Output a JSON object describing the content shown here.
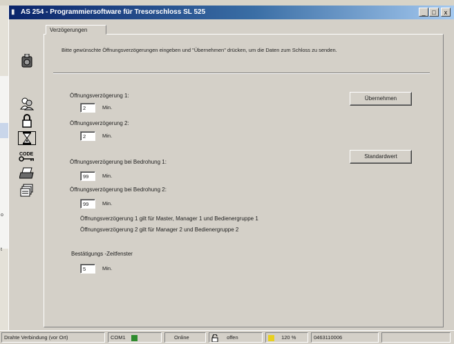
{
  "window": {
    "title": "AS 254 - Programmiersoftware für Tresorschloss SL 525"
  },
  "title_buttons": {
    "minimize": "_",
    "maximize": "□",
    "close": "x"
  },
  "background_window": {
    "labels": [
      "o",
      "t"
    ]
  },
  "tab": {
    "label": "Verzögerungen"
  },
  "sidebar": {
    "items": [
      "connection",
      "users",
      "lock",
      "delay",
      "code",
      "printer",
      "archive"
    ]
  },
  "instructions": "Bitte gewünschte Öffnungsverzögerungen eingeben und \"Übernehmen\" drücken, um die Daten zum Schloss zu senden.",
  "form": {
    "delay1": {
      "label": "Öffnungsverzögerung 1:",
      "value": "2",
      "unit": "Min."
    },
    "delay2": {
      "label": "Öffnungsverzögerung 2:",
      "value": "2",
      "unit": "Min."
    },
    "threat1": {
      "label": "Öffnungsverzögerung bei Bedrohung 1:",
      "value": "99",
      "unit": "Min."
    },
    "threat2": {
      "label": "Öffnungsverzögerung bei Bedrohung 2:",
      "value": "99",
      "unit": "Min."
    },
    "note1": "Öffnungsverzögerung 1 gilt für Master, Manager 1 und Bedienergruppe 1",
    "note2": "Öffnungsverzögerung 2 gilt für Manager 2 und Bedienergruppe 2",
    "confirm": {
      "label": "Bestätigungs -Zeitfenster",
      "value": "5",
      "unit": "Min."
    }
  },
  "buttons": {
    "apply": "Übernehmen",
    "default": "Standardwert"
  },
  "statusbar": {
    "connection": "Drahte Verbindung (vor Ort)",
    "port": "COM1",
    "online": "Online",
    "lock_state": "offen",
    "percent": "120 %",
    "serial": "0463110006"
  },
  "colors": {
    "title_start": "#0a246a",
    "title_end": "#a6caf0",
    "led_green": "#2e8b2e",
    "led_yellow": "#e8d020"
  }
}
